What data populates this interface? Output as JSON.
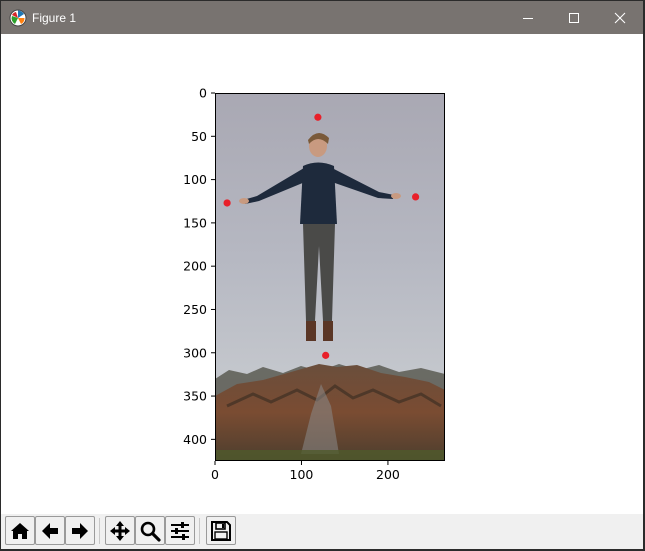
{
  "window": {
    "title": "Figure 1",
    "app_icon": "matplotlib-icon"
  },
  "title_buttons": [
    {
      "name": "minimize-icon"
    },
    {
      "name": "maximize-icon"
    },
    {
      "name": "close-icon"
    }
  ],
  "chart_data": {
    "type": "scatter",
    "description_image": "photo of a man levitating above a rock with arms outstretched",
    "xlim": [
      0,
      266
    ],
    "ylim": [
      425,
      0
    ],
    "x_ticks": [
      0,
      100,
      200
    ],
    "y_ticks": [
      0,
      50,
      100,
      150,
      200,
      250,
      300,
      350,
      400
    ],
    "points": [
      {
        "x": 119,
        "y": 28
      },
      {
        "x": 14,
        "y": 127
      },
      {
        "x": 232,
        "y": 120
      },
      {
        "x": 128,
        "y": 303
      }
    ],
    "marker_color": "#e8202a"
  },
  "toolbar": {
    "buttons": [
      {
        "name": "home-icon"
      },
      {
        "name": "back-icon"
      },
      {
        "name": "forward-icon"
      },
      {
        "name": "pan-icon"
      },
      {
        "name": "zoom-icon"
      },
      {
        "name": "configure-subplots-icon"
      },
      {
        "name": "save-icon"
      }
    ]
  }
}
